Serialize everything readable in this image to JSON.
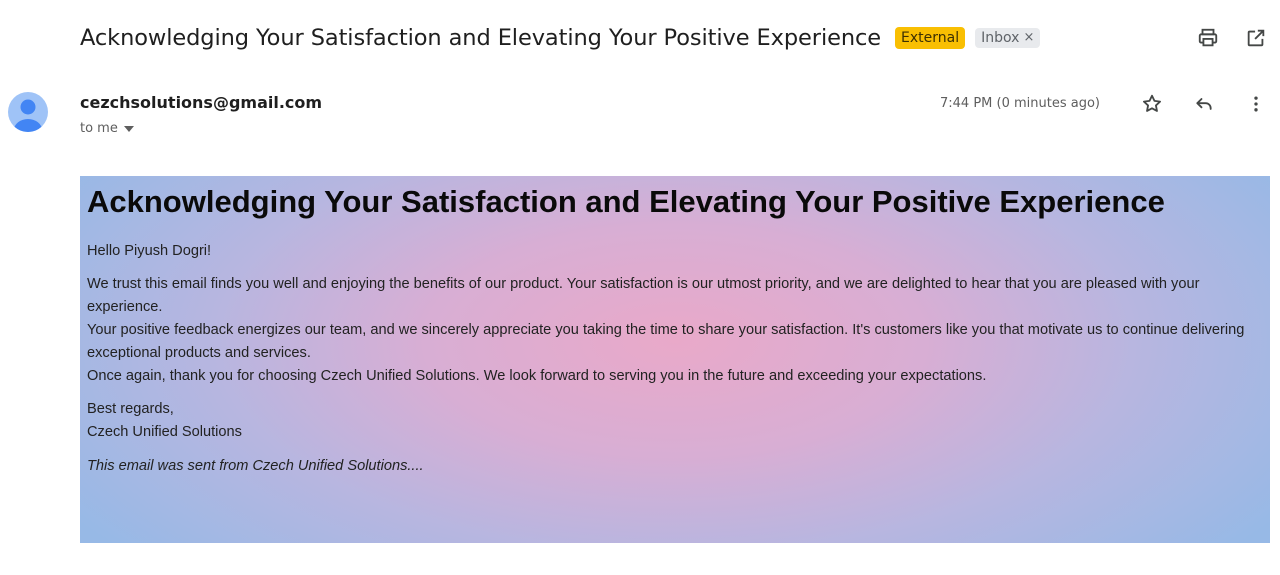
{
  "header": {
    "subject": "Acknowledging Your Satisfaction and Elevating Your Positive Experience",
    "external_badge": "External",
    "inbox_label": "Inbox",
    "inbox_remove": "×"
  },
  "message": {
    "sender": "cezchsolutions@gmail.com",
    "recipient": "to me",
    "time": "7:44 PM (0 minutes ago)"
  },
  "email_body": {
    "heading": "Acknowledging Your Satisfaction and Elevating Your Positive Experience",
    "greeting": "Hello Piyush Dogri!",
    "lines": [
      "We trust this email finds you well and enjoying the benefits of our product. Your satisfaction is our utmost priority, and we are delighted to hear that you are pleased with your experience.",
      "Your positive feedback energizes our team, and we sincerely appreciate you taking the time to share your satisfaction. It's customers like you that motivate us to continue delivering exceptional products and services.",
      "Once again, thank you for choosing Czech Unified Solutions. We look forward to serving you in the future and exceeding your expectations."
    ],
    "closing": "Best regards,",
    "signature": "Czech Unified Solutions",
    "footer": "This email was sent from Czech Unified Solutions...."
  },
  "icons": {
    "print": "print-icon",
    "open_new_window": "open-in-new-window-icon",
    "star": "star-icon",
    "reply": "reply-icon",
    "more": "more-vert-icon",
    "avatar": "avatar-person-icon",
    "dropdown": "caret-down-icon"
  },
  "colors": {
    "external_badge": "#f9bf02",
    "inbox_badge": "#e8eaed",
    "avatar_bg": "#9fc3f7",
    "avatar_figure": "#4285f4",
    "card_center": "#e9a9c9",
    "card_edge": "#97b9e6"
  }
}
